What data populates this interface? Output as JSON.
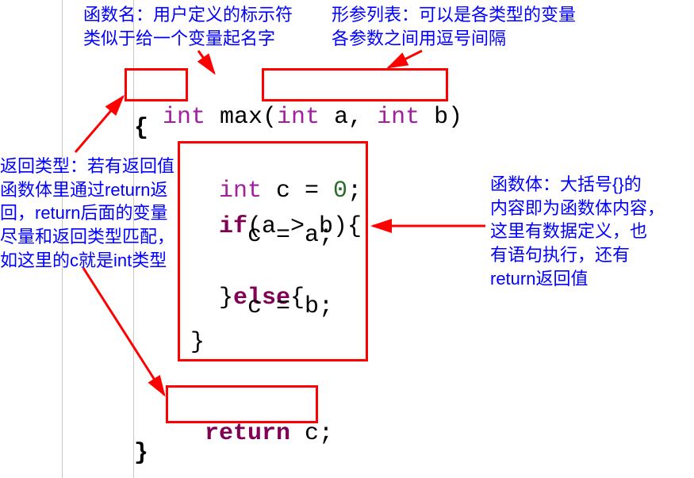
{
  "annotations": {
    "funcName": "函数名：用户定义的标示符\n类似于给一个变量起名字",
    "paramList": "形参列表：可以是各类型的变量\n各参数之间用逗号间隔",
    "returnType": "返回类型：若有返回值\n函数体里通过return返\n回，return后面的变量\n尽量和返回类型匹配，\n如这里的c就是int类型",
    "funcBody": "函数体：大括号{}的\n内容即为函数体内容，\n这里有数据定义，也\n有语句执行，还有\nreturn返回值"
  },
  "code": {
    "sigPart1": "int",
    "sigPart2": " max(",
    "sigPart3": "int",
    "sigPart4": " a, ",
    "sigPart5": "int",
    "sigPart6": " b)",
    "openBrace": "{",
    "bodyLine1a": "int",
    "bodyLine1b": " c = ",
    "bodyLine1c": "0",
    "bodyLine1d": ";",
    "bodyLine2a": "if",
    "bodyLine2b": "(a > b){",
    "bodyLine3": "    c = a;",
    "bodyLine4a": "}",
    "bodyLine4b": "else",
    "bodyLine4c": "{",
    "bodyLine5": "    c = b;",
    "bodyLine6": "}",
    "returnLine1": "return",
    "returnLine2": " c;",
    "closeBrace": "}"
  }
}
